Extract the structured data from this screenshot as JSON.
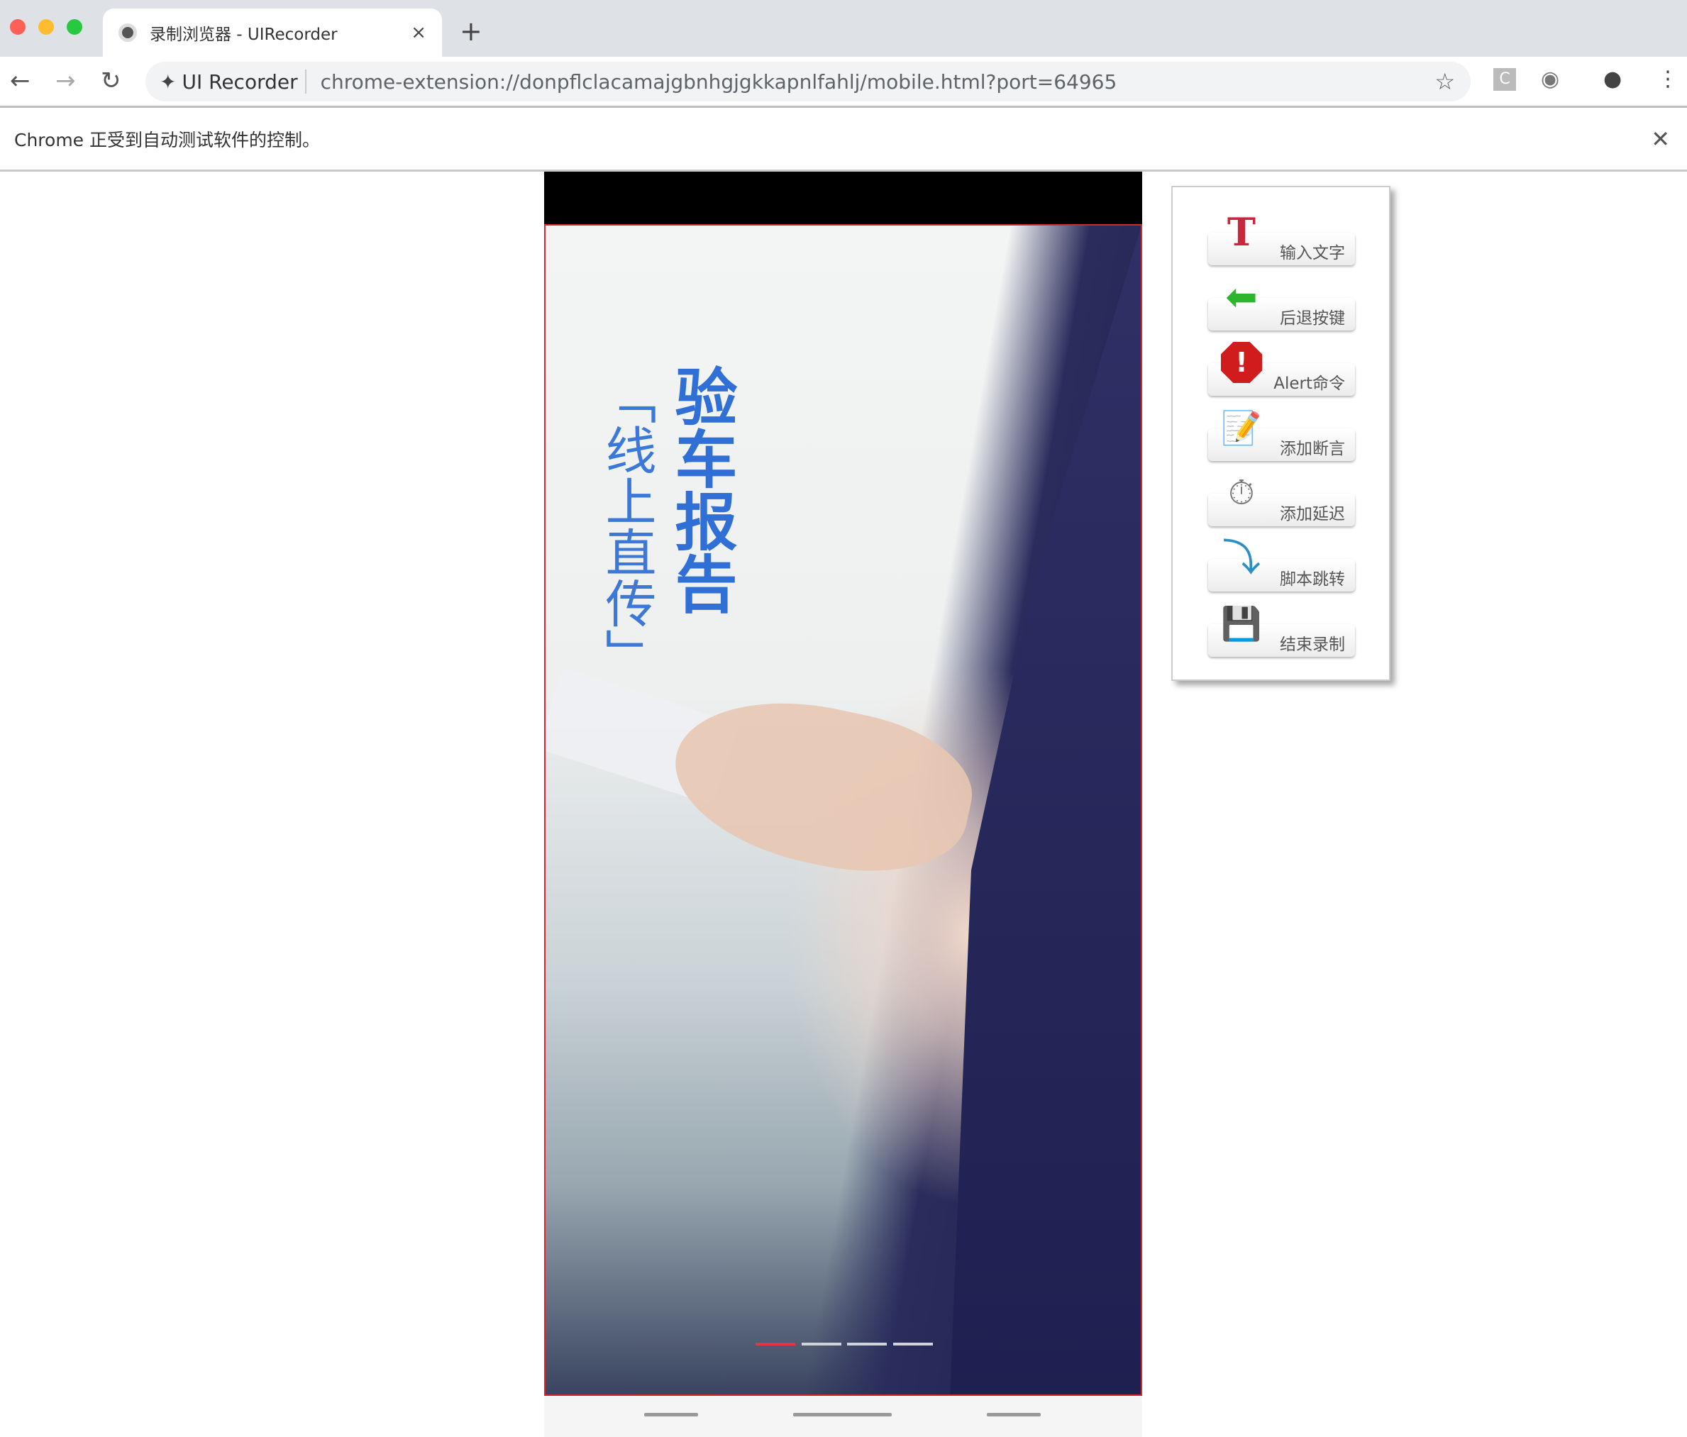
{
  "browser": {
    "tab_title": "录制浏览器 - UIRecorder",
    "tab_close": "×",
    "new_tab": "+",
    "extension_name": "UI Recorder",
    "url": "chrome-extension://donpflclacamajgbnhgjgkkapnlfahlj/mobile.html?port=64965",
    "infobar_text": "Chrome 正受到自动测试软件的控制。",
    "infobar_close": "✕"
  },
  "screen": {
    "headline": "验车报告",
    "subline": "「线上直传」",
    "carousel": {
      "count": 4,
      "active": 0
    },
    "accent_color": "#2f6fd6"
  },
  "panel": {
    "buttons": [
      {
        "label": "输入文字",
        "icon": "text-icon"
      },
      {
        "label": "后退按键",
        "icon": "back-arrow-icon"
      },
      {
        "label": "Alert命令",
        "icon": "alert-icon"
      },
      {
        "label": "添加断言",
        "icon": "checklist-icon"
      },
      {
        "label": "添加延迟",
        "icon": "stopwatch-icon"
      },
      {
        "label": "脚本跳转",
        "icon": "jump-arrow-icon"
      },
      {
        "label": "结束录制",
        "icon": "save-icon"
      }
    ]
  }
}
